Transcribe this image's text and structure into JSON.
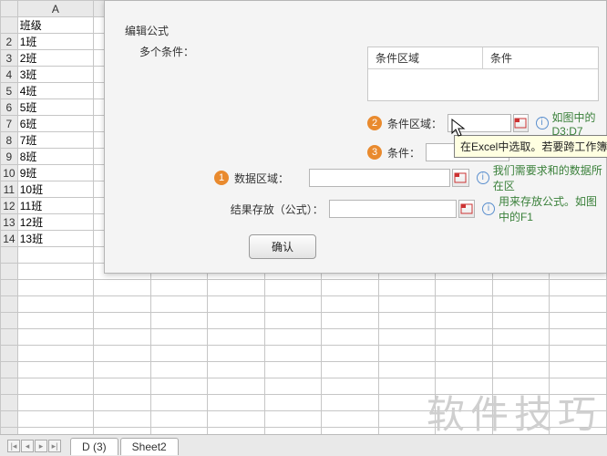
{
  "columnA_header": "A",
  "header_title": "班级",
  "rows": [
    "1班",
    "2班",
    "3班",
    "4班",
    "5班",
    "6班",
    "7班",
    "8班",
    "9班",
    "10班",
    "11班",
    "12班",
    "13班"
  ],
  "row_nums_visible": [
    "9",
    "10"
  ],
  "dialog": {
    "title": "编辑公式",
    "multi_cond": "多个条件：",
    "list_header_left": "条件区域",
    "list_header_right": "条件",
    "step2_label": "条件区域：",
    "step3_label": "条件：",
    "step1_label": "数据区域：",
    "result_label": "结果存放（公式）：",
    "ok": "确认",
    "hint_d3d7": "如图中的D3:D7",
    "hint_sum": "我们需要求和的数据所在区",
    "hint_f": "用来存放公式。如图中的F1",
    "tooltip": "在Excel中选取。若要跨工作簿迈"
  },
  "tabs": {
    "t1": "D (3)",
    "t2": "Sheet2"
  },
  "watermark": "软件技巧",
  "badges": {
    "b1": "1",
    "b2": "2",
    "b3": "3"
  }
}
